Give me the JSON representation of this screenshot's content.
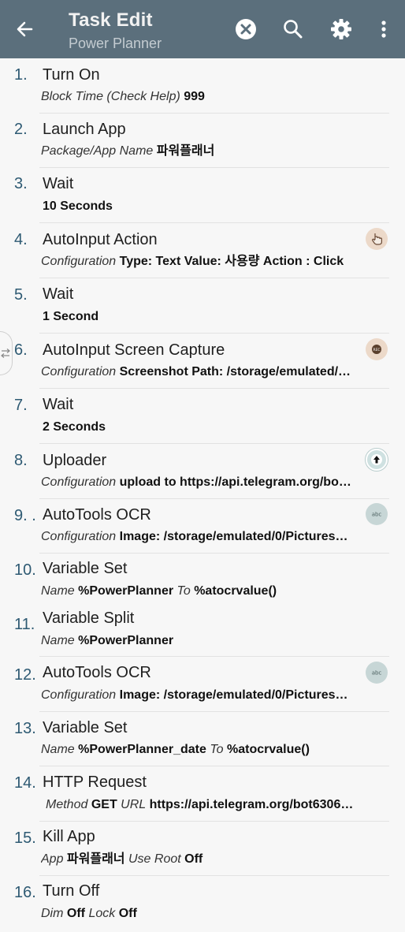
{
  "header": {
    "title": "Task Edit",
    "subtitle": "Power Planner",
    "icons": [
      "back-arrow-icon",
      "cancel-icon",
      "search-icon",
      "gear-icon",
      "more-vert-icon"
    ]
  },
  "actions": [
    {
      "num": "1.",
      "name": "Turn On",
      "params": [
        {
          "label": "Block Time (Check Help)",
          "value": "999"
        }
      ]
    },
    {
      "num": "2.",
      "name": "Launch App",
      "params": [
        {
          "label": "Package/App Name",
          "value": "파워플래너"
        }
      ]
    },
    {
      "num": "3.",
      "name": "Wait",
      "params": [
        {
          "label": "",
          "value": "10 Seconds"
        }
      ]
    },
    {
      "num": "4.",
      "name": "AutoInput Action",
      "params": [
        {
          "label": "Configuration",
          "value": "Type: Text Value: 사용량 Action : Click"
        }
      ],
      "icon": "touch-icon"
    },
    {
      "num": "5.",
      "name": "Wait",
      "params": [
        {
          "label": "",
          "value": "1 Second"
        }
      ]
    },
    {
      "num": "6.",
      "name": "AutoInput Screen Capture",
      "params": [
        {
          "label": "Configuration",
          "value": "Screenshot Path: /storage/emulated/…"
        }
      ],
      "icon": "rec-icon"
    },
    {
      "num": "7.",
      "name": "Wait",
      "params": [
        {
          "label": "",
          "value": "2 Seconds"
        }
      ]
    },
    {
      "num": "8.",
      "name": "Uploader",
      "params": [
        {
          "label": "Configuration",
          "value": "upload to https://api.telegram.org/bo…"
        }
      ],
      "icon": "upload-icon"
    },
    {
      "num": "9. .",
      "name": "AutoTools OCR",
      "params": [
        {
          "label": "Configuration",
          "value": "Image: /storage/emulated/0/Pictures…"
        }
      ],
      "icon": "abc-icon"
    },
    {
      "num": "10.",
      "name": "Variable Set",
      "params": [
        {
          "label": "Name",
          "value": "%PowerPlanner"
        },
        {
          "label": "To",
          "value": "%atocrvalue()"
        }
      ]
    },
    {
      "num": "11.",
      "name": "Variable Split",
      "params": [
        {
          "label": "Name",
          "value": "%PowerPlanner"
        }
      ]
    },
    {
      "num": "12.",
      "name": "AutoTools OCR",
      "params": [
        {
          "label": "Configuration",
          "value": "Image: /storage/emulated/0/Pictures…"
        }
      ],
      "icon": "abc-icon"
    },
    {
      "num": "13.",
      "name": "Variable Set",
      "params": [
        {
          "label": "Name",
          "value": "%PowerPlanner_date"
        },
        {
          "label": "To",
          "value": "%atocrvalue()"
        }
      ]
    },
    {
      "num": "14.",
      "name": "HTTP Request",
      "params": [
        {
          "label": "Method",
          "value": "GET"
        },
        {
          "label": "URL",
          "value": "https://api.telegram.org/bot6306…"
        }
      ]
    },
    {
      "num": "15.",
      "name": "Kill App",
      "params": [
        {
          "label": "App",
          "value": "파워플래너"
        },
        {
          "label": "Use Root",
          "value": "Off"
        }
      ]
    },
    {
      "num": "16.",
      "name": "Turn Off",
      "params": [
        {
          "label": "Dim",
          "value": "Off"
        },
        {
          "label": "Lock",
          "value": "Off"
        }
      ]
    }
  ]
}
